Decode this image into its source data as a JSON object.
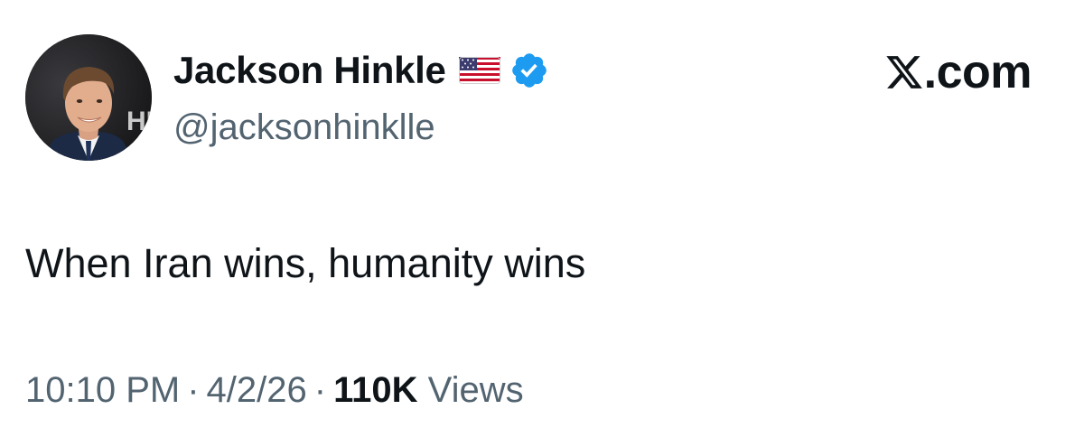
{
  "user": {
    "display_name": "Jackson Hinkle",
    "handle": "@jacksonhinkllе",
    "flag_icon": "us-flag-icon",
    "verified_icon": "verified-badge-icon",
    "avatar_backdrop_text": "HB"
  },
  "brand": {
    "text": ".com",
    "icon": "x-logo-icon"
  },
  "tweet": {
    "text": "When Iran wins, humanity wins"
  },
  "meta": {
    "time": "10:10 PM",
    "separator": "·",
    "date": "4/2/26",
    "views_count": "110K",
    "views_label": "Views"
  },
  "colors": {
    "text_primary": "#0f1419",
    "text_secondary": "#536471",
    "verified_blue": "#1d9bf0"
  }
}
